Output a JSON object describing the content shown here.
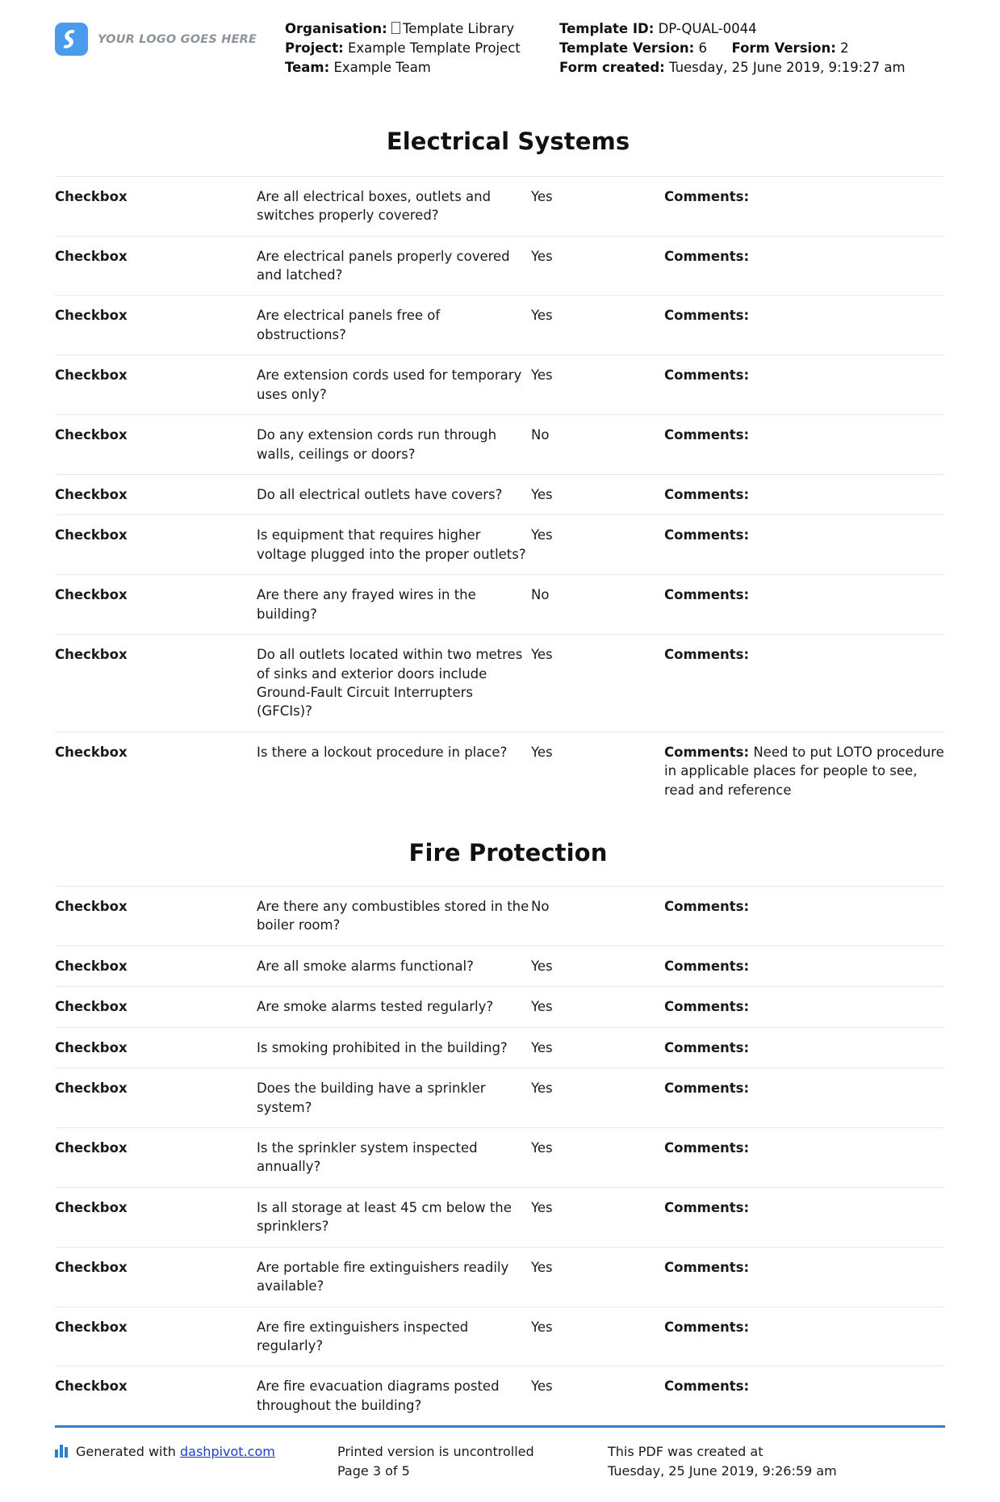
{
  "header": {
    "logo_text": "YOUR LOGO GOES HERE",
    "organisation_label": "Organisation:",
    "organisation_value": "Template Library",
    "project_label": "Project:",
    "project_value": "Example Template Project",
    "team_label": "Team:",
    "team_value": "Example Team",
    "template_id_label": "Template ID:",
    "template_id_value": "DP-QUAL-0044",
    "template_version_label": "Template Version:",
    "template_version_value": "6",
    "form_version_label": "Form Version:",
    "form_version_value": "2",
    "form_created_label": "Form created:",
    "form_created_value": "Tuesday, 25 June 2019, 9:19:27 am",
    "accent_color": "#2f7fd1"
  },
  "sections": [
    {
      "title": "Electrical Systems",
      "rows": [
        {
          "type": "Checkbox",
          "question": "Are all electrical boxes, outlets and switches properly covered?",
          "answer": "Yes",
          "comment_label": "Comments:",
          "comment_value": ""
        },
        {
          "type": "Checkbox",
          "question": "Are electrical panels properly covered and latched?",
          "answer": "Yes",
          "comment_label": "Comments:",
          "comment_value": ""
        },
        {
          "type": "Checkbox",
          "question": "Are electrical panels free of obstructions?",
          "answer": "Yes",
          "comment_label": "Comments:",
          "comment_value": ""
        },
        {
          "type": "Checkbox",
          "question": "Are extension cords used for temporary uses only?",
          "answer": "Yes",
          "comment_label": "Comments:",
          "comment_value": ""
        },
        {
          "type": "Checkbox",
          "question": "Do any extension cords run through walls, ceilings or doors?",
          "answer": "No",
          "comment_label": "Comments:",
          "comment_value": ""
        },
        {
          "type": "Checkbox",
          "question": "Do all electrical outlets have covers?",
          "answer": "Yes",
          "comment_label": "Comments:",
          "comment_value": ""
        },
        {
          "type": "Checkbox",
          "question": "Is equipment that requires higher voltage plugged into the proper outlets?",
          "answer": "Yes",
          "comment_label": "Comments:",
          "comment_value": ""
        },
        {
          "type": "Checkbox",
          "question": "Are there any frayed wires in the building?",
          "answer": "No",
          "comment_label": "Comments:",
          "comment_value": ""
        },
        {
          "type": "Checkbox",
          "question": "Do all outlets located within two metres of sinks and exterior doors include Ground-Fault Circuit Interrupters (GFCIs)?",
          "answer": "Yes",
          "comment_label": "Comments:",
          "comment_value": ""
        },
        {
          "type": "Checkbox",
          "question": "Is there a lockout procedure in place?",
          "answer": "Yes",
          "comment_label": "Comments:",
          "comment_value": " Need to put LOTO procedure in applicable places for people to see, read and reference"
        }
      ]
    },
    {
      "title": "Fire Protection",
      "rows": [
        {
          "type": "Checkbox",
          "question": "Are there any combustibles stored in the boiler room?",
          "answer": "No",
          "comment_label": "Comments:",
          "comment_value": ""
        },
        {
          "type": "Checkbox",
          "question": "Are all smoke alarms functional?",
          "answer": "Yes",
          "comment_label": "Comments:",
          "comment_value": ""
        },
        {
          "type": "Checkbox",
          "question": "Are smoke alarms tested regularly?",
          "answer": "Yes",
          "comment_label": "Comments:",
          "comment_value": ""
        },
        {
          "type": "Checkbox",
          "question": "Is smoking prohibited in the building?",
          "answer": "Yes",
          "comment_label": "Comments:",
          "comment_value": ""
        },
        {
          "type": "Checkbox",
          "question": "Does the building have a sprinkler system?",
          "answer": "Yes",
          "comment_label": "Comments:",
          "comment_value": ""
        },
        {
          "type": "Checkbox",
          "question": "Is the sprinkler system inspected annually?",
          "answer": "Yes",
          "comment_label": "Comments:",
          "comment_value": ""
        },
        {
          "type": "Checkbox",
          "question": "Is all storage at least 45 cm below the sprinklers?",
          "answer": "Yes",
          "comment_label": "Comments:",
          "comment_value": ""
        },
        {
          "type": "Checkbox",
          "question": "Are portable fire extinguishers readily available?",
          "answer": "Yes",
          "comment_label": "Comments:",
          "comment_value": ""
        },
        {
          "type": "Checkbox",
          "question": "Are fire extinguishers inspected regularly?",
          "answer": "Yes",
          "comment_label": "Comments:",
          "comment_value": ""
        },
        {
          "type": "Checkbox",
          "question": "Are fire evacuation diagrams posted throughout the building?",
          "answer": "Yes",
          "comment_label": "Comments:",
          "comment_value": ""
        }
      ]
    }
  ],
  "footer": {
    "generated_prefix": "Generated with ",
    "generated_link": "dashpivot.com",
    "printed_notice": "Printed version is uncontrolled",
    "page_number": "Page 3 of 5",
    "pdf_created_label": "This PDF was created at",
    "pdf_created_value": "Tuesday, 25 June 2019, 9:26:59 am"
  }
}
